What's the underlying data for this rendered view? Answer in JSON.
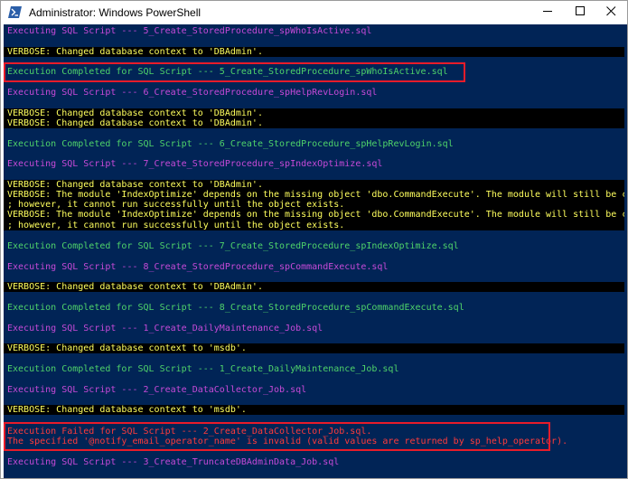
{
  "window": {
    "title": "Administrator: Windows PowerShell"
  },
  "colors": {
    "console_background": "#012456",
    "executing_text": "#c74ad8",
    "completed_text": "#4fd36a",
    "verbose_text": "#ffff5e",
    "failed_text": "#ff3b3b",
    "highlight_border": "#e81c2a"
  },
  "icons": {
    "app": "powershell-icon",
    "minimize": "minimize-icon",
    "maximize": "maximize-icon",
    "close": "close-icon"
  },
  "console": {
    "lines": [
      "Executing SQL Script --- 5_Create_StoredProcedure_spWhoIsActive.sql",
      "VERBOSE: Changed database context to 'DBAdmin'.",
      "Execution Completed for SQL Script --- 5_Create_StoredProcedure_spWhoIsActive.sql",
      "Executing SQL Script --- 6_Create_StoredProcedure_spHelpRevLogin.sql",
      "VERBOSE: Changed database context to 'DBAdmin'.",
      "VERBOSE: Changed database context to 'DBAdmin'.",
      "Execution Completed for SQL Script --- 6_Create_StoredProcedure_spHelpRevLogin.sql",
      "Executing SQL Script --- 7_Create_StoredProcedure_spIndexOptimize.sql",
      "VERBOSE: Changed database context to 'DBAdmin'.",
      "VERBOSE: The module 'IndexOptimize' depends on the missing object 'dbo.CommandExecute'. The module will still be created",
      "; however, it cannot run successfully until the object exists.",
      "VERBOSE: The module 'IndexOptimize' depends on the missing object 'dbo.CommandExecute'. The module will still be created",
      "; however, it cannot run successfully until the object exists.",
      "Execution Completed for SQL Script --- 7_Create_StoredProcedure_spIndexOptimize.sql",
      "Executing SQL Script --- 8_Create_StoredProcedure_spCommandExecute.sql",
      "VERBOSE: Changed database context to 'DBAdmin'.",
      "Execution Completed for SQL Script --- 8_Create_StoredProcedure_spCommandExecute.sql",
      "Executing SQL Script --- 1_Create_DailyMaintenance_Job.sql",
      "VERBOSE: Changed database context to 'msdb'.",
      "Execution Completed for SQL Script --- 1_Create_DailyMaintenance_Job.sql",
      "Executing SQL Script --- 2_Create_DataCollector_Job.sql",
      "VERBOSE: Changed database context to 'msdb'.",
      "Execution Failed for SQL Script --- 2_Create_DataCollector_Job.sql.",
      "The specified '@notify_email_operator_name' is invalid (valid values are returned by sp_help_operator).",
      "Executing SQL Script --- 3_Create_TruncateDBAdminData_Job.sql"
    ]
  }
}
